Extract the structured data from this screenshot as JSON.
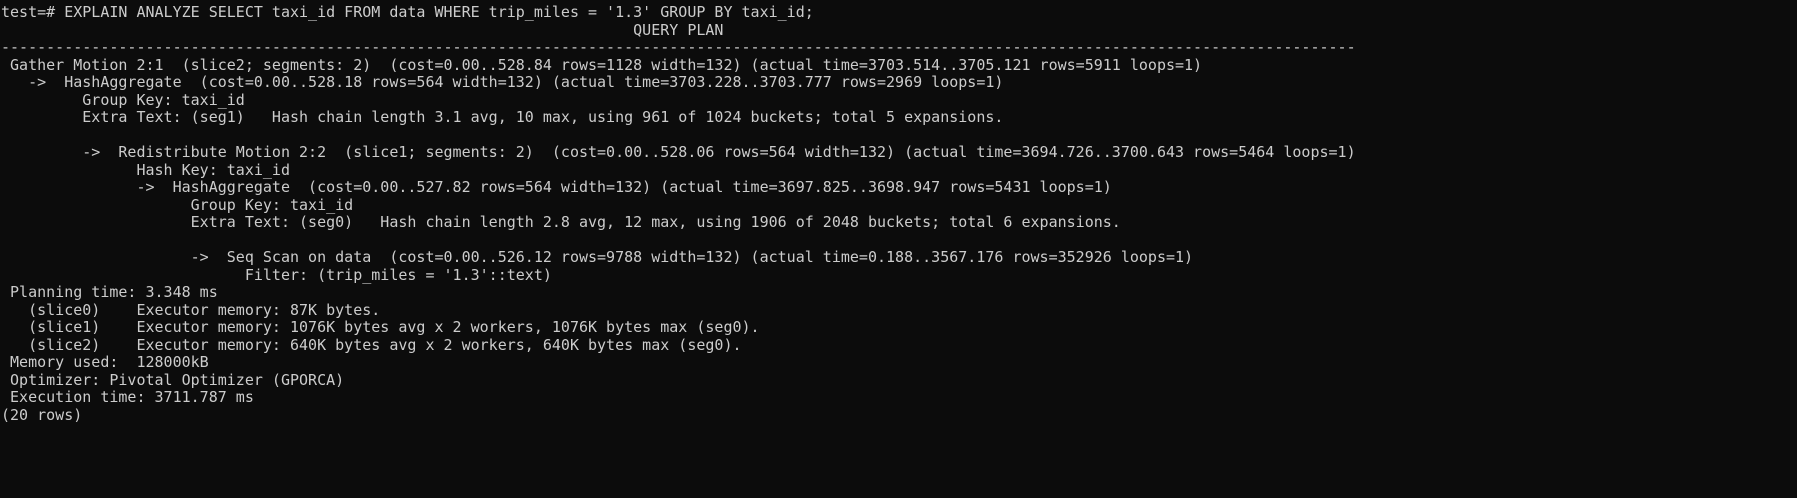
{
  "terminal": {
    "lines": [
      "test=# EXPLAIN ANALYZE SELECT taxi_id FROM data WHERE trip_miles = '1.3' GROUP BY taxi_id;",
      "                                                                      QUERY PLAN",
      "------------------------------------------------------------------------------------------------------------------------------------------------------",
      " Gather Motion 2:1  (slice2; segments: 2)  (cost=0.00..528.84 rows=1128 width=132) (actual time=3703.514..3705.121 rows=5911 loops=1)",
      "   ->  HashAggregate  (cost=0.00..528.18 rows=564 width=132) (actual time=3703.228..3703.777 rows=2969 loops=1)",
      "         Group Key: taxi_id",
      "         Extra Text: (seg1)   Hash chain length 3.1 avg, 10 max, using 961 of 1024 buckets; total 5 expansions.",
      "",
      "         ->  Redistribute Motion 2:2  (slice1; segments: 2)  (cost=0.00..528.06 rows=564 width=132) (actual time=3694.726..3700.643 rows=5464 loops=1)",
      "               Hash Key: taxi_id",
      "               ->  HashAggregate  (cost=0.00..527.82 rows=564 width=132) (actual time=3697.825..3698.947 rows=5431 loops=1)",
      "                     Group Key: taxi_id",
      "                     Extra Text: (seg0)   Hash chain length 2.8 avg, 12 max, using 1906 of 2048 buckets; total 6 expansions.",
      "",
      "                     ->  Seq Scan on data  (cost=0.00..526.12 rows=9788 width=132) (actual time=0.188..3567.176 rows=352926 loops=1)",
      "                           Filter: (trip_miles = '1.3'::text)",
      " Planning time: 3.348 ms",
      "   (slice0)    Executor memory: 87K bytes.",
      "   (slice1)    Executor memory: 1076K bytes avg x 2 workers, 1076K bytes max (seg0).",
      "   (slice2)    Executor memory: 640K bytes avg x 2 workers, 640K bytes max (seg0).",
      " Memory used:  128000kB",
      " Optimizer: Pivotal Optimizer (GPORCA)",
      " Execution time: 3711.787 ms",
      "(20 rows)"
    ]
  }
}
